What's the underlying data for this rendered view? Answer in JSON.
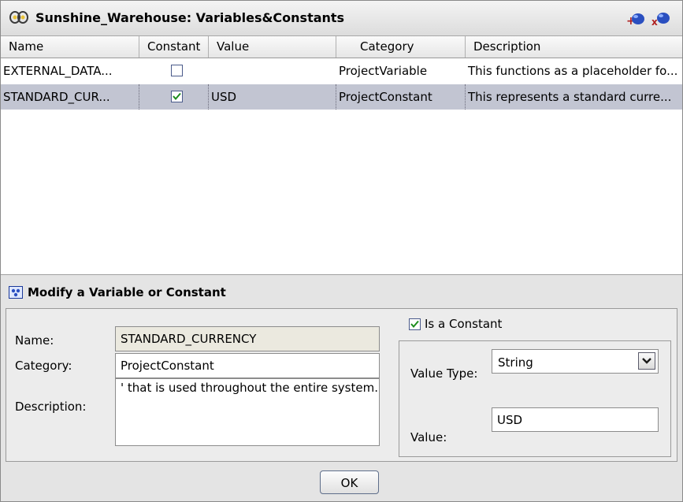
{
  "window": {
    "title": "Sunshine_Warehouse: Variables&Constants",
    "add_icon": "add-blob-icon",
    "remove_icon": "remove-blob-icon"
  },
  "table": {
    "columns": [
      "Name",
      "Constant",
      "Value",
      "Category",
      "Description"
    ],
    "rows": [
      {
        "name": "EXTERNAL_DATA...",
        "constant": false,
        "value": "",
        "category": "ProjectVariable",
        "description": "This functions as a placeholder fo..."
      },
      {
        "name": "STANDARD_CUR...",
        "constant": true,
        "value": "USD",
        "category": "ProjectConstant",
        "description": "This represents a standard curre..."
      }
    ],
    "selected_row": 1
  },
  "section": {
    "title": "Modify a Variable or Constant"
  },
  "form": {
    "name_label": "Name:",
    "name_value": "STANDARD_CURRENCY",
    "category_label": "Category:",
    "category_value": "ProjectConstant",
    "description_label": "Description:",
    "description_value": "' that is used throughout the entire system.",
    "is_constant_label": "Is a Constant",
    "is_constant": true,
    "value_type_label": "Value Type:",
    "value_type_selected": "String",
    "value_label": "Value:",
    "value_value": "USD"
  },
  "footer": {
    "ok_label": "OK"
  },
  "colors": {
    "selected_row": "#c2c5d2",
    "check": "#1c8c1c"
  }
}
